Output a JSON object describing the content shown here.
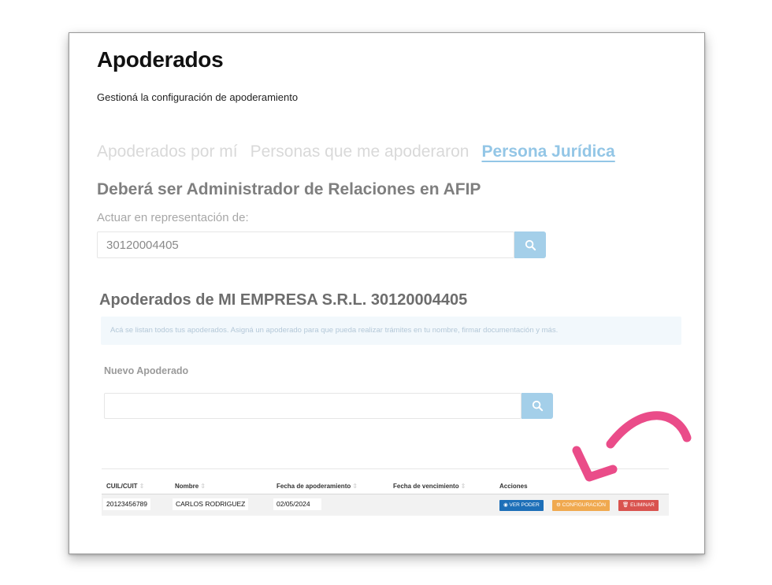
{
  "header": {
    "title": "Apoderados",
    "subtitle": "Gestioná la configuración de apoderamiento"
  },
  "tabs": [
    {
      "label": "Apoderados por mí",
      "active": false
    },
    {
      "label": "Personas que me apoderaron",
      "active": false
    },
    {
      "label": "Persona Jurídica",
      "active": true
    }
  ],
  "representation": {
    "heading": "Deberá ser Administrador de Relaciones en AFIP",
    "label": "Actuar en representación de:",
    "value": "30120004405",
    "search_icon": "search-icon"
  },
  "company": {
    "title": "Apoderados de MI EMPRESA S.R.L. 30120004405",
    "info": "Acá se listan todos tus apoderados. Asigná un apoderado para que pueda realizar trámites en tu nombre, firmar documentación y más."
  },
  "nuevo": {
    "label": "Nuevo Apoderado",
    "value": "",
    "search_icon": "search-icon"
  },
  "table": {
    "columns": [
      "CUIL/CUIT",
      "Nombre",
      "Fecha de apoderamiento",
      "Fecha de vencimiento",
      "Acciones"
    ],
    "sort_glyph": "⇕",
    "rows": [
      {
        "cuil": "20123456789",
        "nombre": "CARLOS RODRIGUEZ",
        "fecha_apoderamiento": "02/05/2024",
        "fecha_vencimiento": ""
      }
    ],
    "actions": {
      "ver": "VER PODER",
      "config": "CONFIGURACIÓN",
      "eliminar": "ELIMINAR"
    }
  },
  "colors": {
    "accent": "#93c6e6",
    "search_button": "#a4cfe9",
    "btn_ver": "#1d6fb8",
    "btn_config": "#f0a94f",
    "btn_eliminar": "#d9534f",
    "annotation_arrow": "#ea4c89"
  }
}
